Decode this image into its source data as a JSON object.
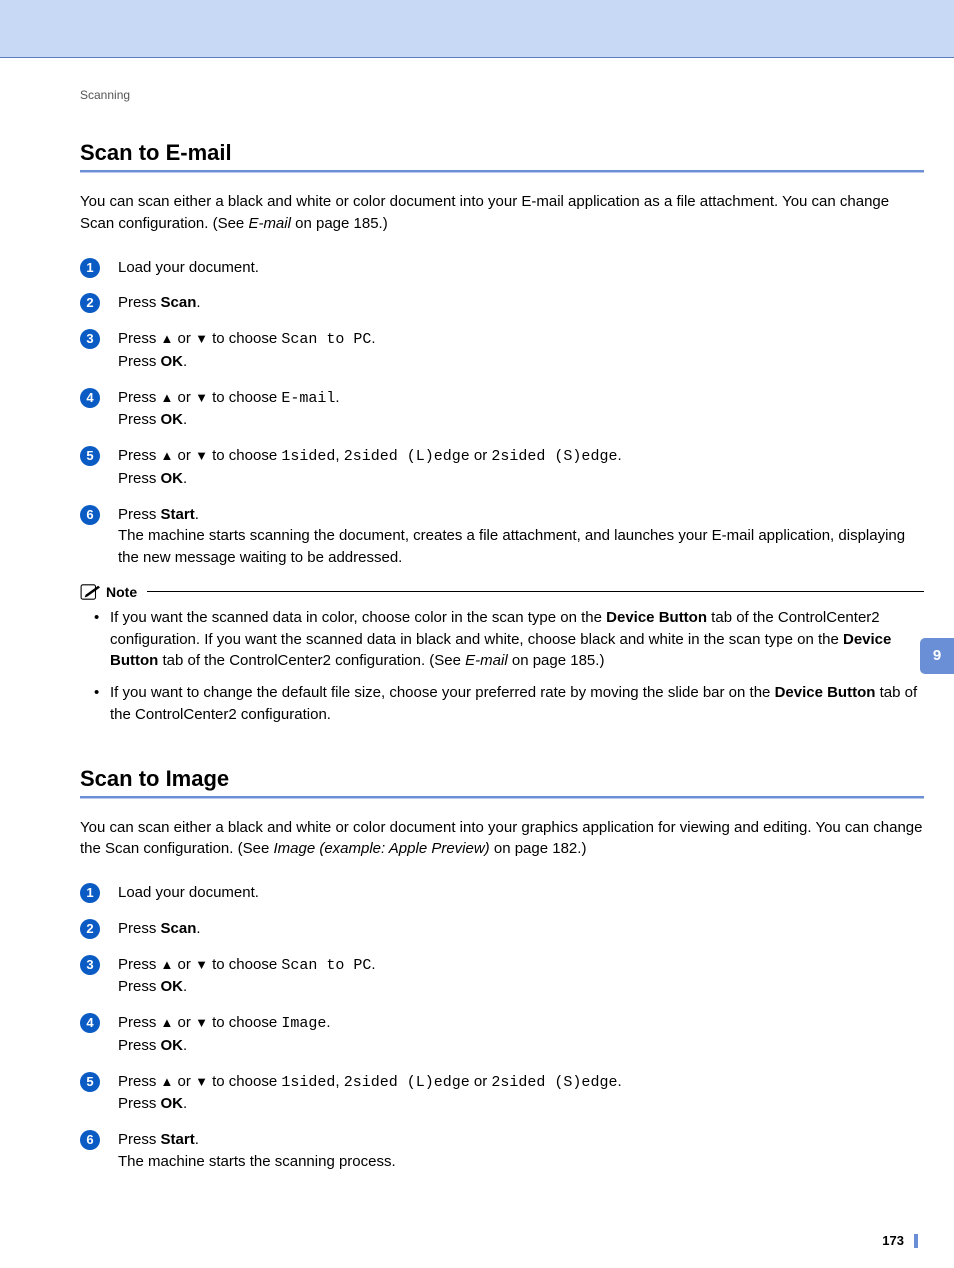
{
  "header": "Scanning",
  "chapterTab": "9",
  "pageNumber": "173",
  "arrows": {
    "up": "▲",
    "down": "▼"
  },
  "sec1": {
    "title": "Scan to E-mail",
    "intro": {
      "t1": "You can scan either a black and white or color document into your E-mail application as a file attachment. You can change Scan configuration. (See ",
      "link": "E-mail",
      "t2": " on page 185.)"
    },
    "s1": "Load your document.",
    "s2a": "Press ",
    "s2b": "Scan",
    "s2c": ".",
    "s3a": "Press ",
    "s3b": " or ",
    "s3c": " to choose ",
    "s3mono": "Scan to PC",
    "s3d": ".",
    "s3e": "Press ",
    "s3f": "OK",
    "s3g": ".",
    "s4a": "Press ",
    "s4b": " or ",
    "s4c": " to choose ",
    "s4mono": "E-mail",
    "s4d": ".",
    "s4e": "Press ",
    "s4f": "OK",
    "s4g": ".",
    "s5a": "Press ",
    "s5b": " or ",
    "s5c": " to choose ",
    "s5m1": "1sided",
    "s5m1a": ", ",
    "s5m2": "2sided (L)edge",
    "s5m2a": " or ",
    "s5m3": "2sided (S)edge",
    "s5d": ".",
    "s5e": "Press ",
    "s5f": "OK",
    "s5g": ".",
    "s6a": "Press ",
    "s6b": "Start",
    "s6c": ".",
    "s6d": "The machine starts scanning the document, creates a file attachment, and launches your E-mail application, displaying the new message waiting to be addressed.",
    "note": {
      "label": "Note",
      "n1a": "If you want the scanned data in color, choose color in the scan type on the ",
      "n1b": "Device Button",
      "n1c": " tab of the ControlCenter2 configuration. If you want the scanned data in black and white, choose black and white in the scan type on the ",
      "n1d": "Device Button",
      "n1e": " tab of the ControlCenter2 configuration. (See ",
      "n1link": "E-mail",
      "n1f": " on page 185.)",
      "n2a": "If you want to change the default file size, choose your preferred rate by moving the slide bar on the ",
      "n2b": "Device Button",
      "n2c": " tab of the ControlCenter2 configuration."
    }
  },
  "sec2": {
    "title": "Scan to Image",
    "intro": {
      "t1": "You can scan either a black and white or color document into your graphics application for viewing and editing. You can change the Scan configuration. (See ",
      "link": "Image (example: Apple Preview)",
      "t2": " on page 182.)"
    },
    "s1": "Load your document.",
    "s2a": "Press ",
    "s2b": "Scan",
    "s2c": ".",
    "s3a": "Press ",
    "s3b": " or ",
    "s3c": " to choose ",
    "s3mono": "Scan to PC",
    "s3d": ".",
    "s3e": "Press ",
    "s3f": "OK",
    "s3g": ".",
    "s4a": "Press ",
    "s4b": " or ",
    "s4c": " to choose ",
    "s4mono": "Image",
    "s4d": ".",
    "s4e": "Press ",
    "s4f": "OK",
    "s4g": ".",
    "s5a": "Press ",
    "s5b": " or ",
    "s5c": " to choose ",
    "s5m1": "1sided",
    "s5m1a": ", ",
    "s5m2": "2sided (L)edge",
    "s5m2a": " or ",
    "s5m3": "2sided (S)edge",
    "s5d": ".",
    "s5e": "Press ",
    "s5f": "OK",
    "s5g": ".",
    "s6a": "Press ",
    "s6b": "Start",
    "s6c": ".",
    "s6d": "The machine starts the scanning process."
  }
}
